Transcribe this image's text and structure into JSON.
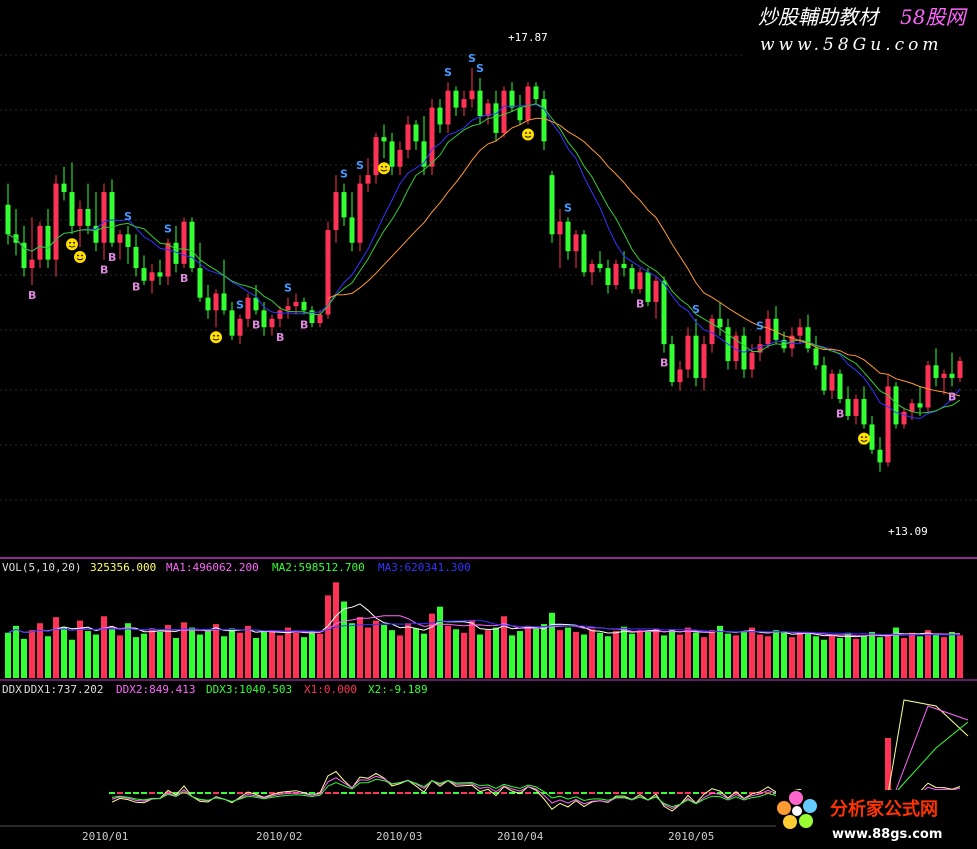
{
  "watermarks": {
    "top_title_a": "炒股輔助教材",
    "top_title_b": "58股网",
    "top_url": "www.58Gu.com",
    "bottom_title": "分析家公式网",
    "bottom_url": "www.88gs.com"
  },
  "colors": {
    "up": "#ff3355",
    "down": "#33ff33",
    "ma_blue": "#3333ff",
    "ma_green": "#33cc33",
    "ma_orange": "#ff9933",
    "divider": "#cc33cc",
    "grid": "#555555",
    "buy": "#dd88dd",
    "sell": "#4499ff",
    "smiley": "#ffdd00"
  },
  "price_panel": {
    "high_label": "+17.87",
    "low_label": "+13.09",
    "buy_marker": "B",
    "sell_marker": "S"
  },
  "vol_panel": {
    "name": "VOL(5,10,20)",
    "value": "325356.000",
    "ma1": "MA1:496062.200",
    "ma2": "MA2:598512.700",
    "ma3": "MA3:620341.300"
  },
  "ddx_panel": {
    "name": "DDX",
    "ddx1": "DDX1:737.202",
    "ddx2": "DDX2:849.413",
    "ddx3": "DDX3:1040.503",
    "x1": "X1:0.000",
    "x2": "X2:-9.189"
  },
  "x_axis": {
    "labels": [
      "2010/01",
      "2010/02",
      "2010/03",
      "2010/04",
      "2010/05"
    ]
  },
  "chart_data": {
    "type": "candlestick",
    "price_range": [
      12.4,
      18.2
    ],
    "max_price": 17.87,
    "min_price": 13.09,
    "ohlc": [
      [
        16.25,
        16.5,
        15.78,
        15.9
      ],
      [
        15.9,
        16.2,
        15.65,
        15.8
      ],
      [
        15.8,
        16.0,
        15.4,
        15.5
      ],
      [
        15.5,
        16.1,
        15.3,
        15.6
      ],
      [
        15.6,
        16.05,
        15.5,
        16.0
      ],
      [
        16.0,
        16.2,
        15.5,
        15.6
      ],
      [
        15.6,
        16.6,
        15.4,
        16.5
      ],
      [
        16.5,
        16.7,
        16.3,
        16.4
      ],
      [
        16.4,
        16.75,
        15.9,
        16.0
      ],
      [
        16.0,
        16.3,
        15.75,
        16.2
      ],
      [
        16.2,
        16.5,
        15.9,
        16.0
      ],
      [
        16.0,
        16.4,
        15.7,
        15.8
      ],
      [
        15.8,
        16.5,
        15.6,
        16.4
      ],
      [
        16.4,
        16.55,
        15.75,
        15.8
      ],
      [
        15.8,
        15.95,
        15.6,
        15.9
      ],
      [
        15.9,
        16.0,
        15.55,
        15.75
      ],
      [
        15.75,
        15.9,
        15.4,
        15.5
      ],
      [
        15.5,
        15.65,
        15.3,
        15.35
      ],
      [
        15.35,
        15.55,
        15.2,
        15.45
      ],
      [
        15.45,
        15.6,
        15.3,
        15.4
      ],
      [
        15.4,
        15.85,
        15.3,
        15.8
      ],
      [
        15.8,
        16.0,
        15.45,
        15.55
      ],
      [
        15.55,
        16.1,
        15.5,
        16.05
      ],
      [
        16.05,
        16.1,
        15.45,
        15.5
      ],
      [
        15.5,
        15.8,
        15.1,
        15.15
      ],
      [
        15.15,
        15.3,
        14.9,
        15.0
      ],
      [
        15.0,
        15.25,
        14.8,
        15.2
      ],
      [
        15.2,
        15.6,
        14.95,
        15.0
      ],
      [
        15.0,
        15.1,
        14.65,
        14.7
      ],
      [
        14.7,
        14.95,
        14.6,
        14.9
      ],
      [
        14.9,
        15.2,
        14.8,
        15.15
      ],
      [
        15.15,
        15.3,
        14.95,
        15.0
      ],
      [
        15.0,
        15.1,
        14.7,
        14.8
      ],
      [
        14.8,
        14.95,
        14.7,
        14.9
      ],
      [
        14.9,
        15.05,
        14.8,
        15.0
      ],
      [
        15.0,
        15.15,
        14.9,
        15.05
      ],
      [
        15.05,
        15.2,
        14.95,
        15.1
      ],
      [
        15.1,
        15.15,
        14.95,
        15.0
      ],
      [
        15.0,
        15.05,
        14.8,
        14.85
      ],
      [
        14.85,
        15.0,
        14.8,
        14.95
      ],
      [
        14.95,
        16.05,
        14.9,
        15.95
      ],
      [
        15.95,
        16.6,
        15.8,
        16.4
      ],
      [
        16.4,
        16.5,
        16.0,
        16.1
      ],
      [
        16.1,
        16.4,
        15.7,
        15.8
      ],
      [
        15.8,
        16.6,
        15.7,
        16.5
      ],
      [
        16.5,
        16.8,
        16.4,
        16.6
      ],
      [
        16.6,
        17.1,
        16.5,
        17.05
      ],
      [
        17.05,
        17.2,
        16.8,
        17.0
      ],
      [
        17.0,
        17.1,
        16.6,
        16.7
      ],
      [
        16.7,
        17.0,
        16.6,
        16.9
      ],
      [
        16.9,
        17.3,
        16.8,
        17.2
      ],
      [
        17.2,
        17.25,
        16.9,
        17.0
      ],
      [
        17.0,
        17.3,
        16.6,
        16.7
      ],
      [
        16.7,
        17.5,
        16.6,
        17.4
      ],
      [
        17.4,
        17.5,
        17.1,
        17.2
      ],
      [
        17.2,
        17.7,
        17.1,
        17.6
      ],
      [
        17.6,
        17.65,
        17.3,
        17.4
      ],
      [
        17.4,
        17.6,
        17.3,
        17.5
      ],
      [
        17.5,
        17.87,
        17.4,
        17.6
      ],
      [
        17.6,
        17.75,
        17.2,
        17.3
      ],
      [
        17.3,
        17.5,
        17.2,
        17.45
      ],
      [
        17.45,
        17.6,
        17.0,
        17.1
      ],
      [
        17.1,
        17.65,
        17.05,
        17.6
      ],
      [
        17.6,
        17.7,
        17.35,
        17.4
      ],
      [
        17.4,
        17.55,
        17.2,
        17.25
      ],
      [
        17.25,
        17.7,
        17.2,
        17.65
      ],
      [
        17.65,
        17.7,
        17.45,
        17.5
      ],
      [
        17.5,
        17.6,
        16.9,
        17.0
      ],
      [
        16.6,
        16.65,
        15.8,
        15.9
      ],
      [
        15.9,
        16.2,
        15.5,
        16.05
      ],
      [
        16.05,
        16.1,
        15.6,
        15.7
      ],
      [
        15.7,
        15.95,
        15.5,
        15.9
      ],
      [
        15.9,
        15.95,
        15.4,
        15.45
      ],
      [
        15.45,
        15.6,
        15.3,
        15.55
      ],
      [
        15.55,
        15.7,
        15.45,
        15.5
      ],
      [
        15.5,
        15.6,
        15.2,
        15.3
      ],
      [
        15.3,
        15.6,
        15.25,
        15.55
      ],
      [
        15.55,
        15.7,
        15.4,
        15.5
      ],
      [
        15.5,
        15.55,
        15.2,
        15.25
      ],
      [
        15.25,
        15.5,
        15.2,
        15.45
      ],
      [
        15.45,
        15.5,
        15.05,
        15.1
      ],
      [
        15.1,
        15.4,
        14.9,
        15.35
      ],
      [
        15.35,
        15.4,
        14.5,
        14.6
      ],
      [
        14.6,
        14.7,
        14.1,
        14.15
      ],
      [
        14.15,
        14.4,
        14.05,
        14.3
      ],
      [
        14.3,
        14.8,
        14.2,
        14.7
      ],
      [
        14.7,
        14.9,
        14.1,
        14.2
      ],
      [
        14.2,
        14.7,
        14.05,
        14.6
      ],
      [
        14.6,
        14.95,
        14.5,
        14.9
      ],
      [
        14.9,
        15.1,
        14.7,
        14.8
      ],
      [
        14.8,
        14.9,
        14.3,
        14.4
      ],
      [
        14.4,
        14.75,
        14.3,
        14.7
      ],
      [
        14.7,
        14.8,
        14.2,
        14.3
      ],
      [
        14.3,
        14.6,
        14.2,
        14.5
      ],
      [
        14.5,
        14.7,
        14.4,
        14.6
      ],
      [
        14.6,
        15.0,
        14.55,
        14.9
      ],
      [
        14.9,
        15.05,
        14.6,
        14.65
      ],
      [
        14.65,
        14.75,
        14.5,
        14.55
      ],
      [
        14.55,
        14.8,
        14.45,
        14.7
      ],
      [
        14.7,
        14.9,
        14.6,
        14.8
      ],
      [
        14.8,
        14.95,
        14.5,
        14.55
      ],
      [
        14.55,
        14.7,
        14.3,
        14.35
      ],
      [
        14.35,
        14.45,
        14.0,
        14.05
      ],
      [
        14.05,
        14.3,
        13.95,
        14.25
      ],
      [
        14.25,
        14.3,
        13.9,
        13.95
      ],
      [
        13.95,
        14.1,
        13.7,
        13.75
      ],
      [
        13.75,
        14.0,
        13.65,
        13.95
      ],
      [
        13.95,
        14.1,
        13.6,
        13.65
      ],
      [
        13.65,
        13.75,
        13.3,
        13.35
      ],
      [
        13.35,
        13.5,
        13.09,
        13.2
      ],
      [
        13.2,
        14.25,
        13.15,
        14.1
      ],
      [
        14.1,
        14.15,
        13.6,
        13.65
      ],
      [
        13.65,
        13.85,
        13.6,
        13.8
      ],
      [
        13.8,
        13.95,
        13.7,
        13.9
      ],
      [
        13.9,
        14.1,
        13.75,
        13.85
      ],
      [
        13.85,
        14.4,
        13.8,
        14.35
      ],
      [
        14.35,
        14.55,
        14.1,
        14.2
      ],
      [
        14.2,
        14.3,
        14.0,
        14.25
      ],
      [
        14.25,
        14.5,
        14.1,
        14.2
      ],
      [
        14.2,
        14.45,
        14.15,
        14.4
      ]
    ],
    "volume": [
      52,
      60,
      45,
      55,
      63,
      48,
      70,
      58,
      44,
      66,
      54,
      50,
      71,
      56,
      49,
      63,
      47,
      51,
      57,
      53,
      61,
      46,
      64,
      58,
      50,
      55,
      62,
      48,
      57,
      52,
      60,
      46,
      53,
      55,
      49,
      58,
      52,
      47,
      54,
      51,
      95,
      110,
      88,
      63,
      70,
      58,
      66,
      61,
      55,
      49,
      63,
      57,
      51,
      74,
      82,
      60,
      56,
      52,
      66,
      50,
      55,
      58,
      71,
      49,
      54,
      60,
      57,
      62,
      75,
      55,
      58,
      53,
      50,
      56,
      52,
      48,
      54,
      59,
      51,
      55,
      53,
      57,
      49,
      56,
      50,
      58,
      52,
      47,
      55,
      60,
      51,
      49,
      54,
      58,
      50,
      48,
      55,
      52,
      47,
      53,
      51,
      48,
      44,
      50,
      46,
      52,
      45,
      49,
      53,
      47,
      50,
      58,
      46,
      52,
      48,
      55,
      50,
      47,
      53,
      49
    ],
    "volume_note": "relative bar heights (units of 10,000 shares, approx.)",
    "sells": [
      15,
      20,
      29,
      35,
      42,
      44,
      55,
      58,
      59,
      70,
      86,
      94
    ],
    "buys": [
      3,
      12,
      13,
      16,
      22,
      31,
      34,
      37,
      79,
      82,
      104,
      118
    ],
    "smileys": [
      8,
      9,
      26,
      47,
      65,
      107
    ]
  }
}
